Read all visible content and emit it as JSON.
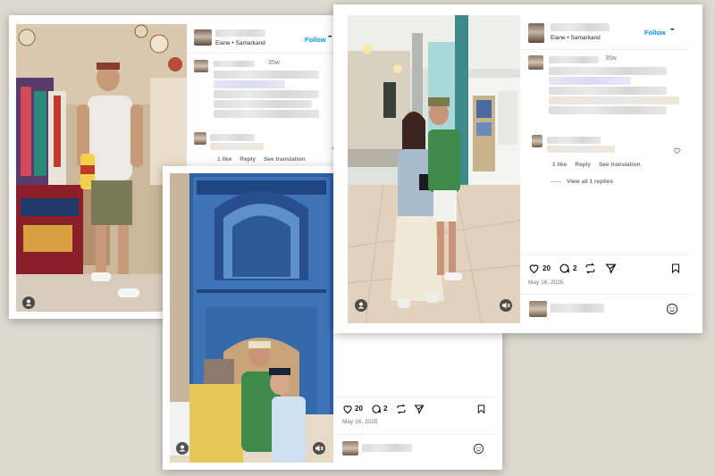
{
  "colors": {
    "background": "#dcd9cf",
    "link_blue": "#0095f6",
    "muted_text": "#737373",
    "tile_blue": "#2f5fa4"
  },
  "post1": {
    "author_location": "Elane • Samarkand",
    "follow_label": "Follow",
    "more_icon": "•••",
    "comment_age": "35w",
    "meta": {
      "likes": "1 like",
      "reply": "Reply",
      "translation": "See translation"
    }
  },
  "post2": {
    "like_count": "20",
    "comment_count": "2",
    "date": "May 16, 2025"
  },
  "post3": {
    "author_location": "Elane • Samarkand",
    "follow_label": "Follow",
    "more_icon": "•••",
    "comment_age": "35w",
    "meta": {
      "likes": "1 like",
      "reply": "Reply",
      "translation": "See translation"
    },
    "view_replies": "View all 1 replies",
    "like_count": "20",
    "comment_count": "2",
    "date": "May 16, 2025"
  }
}
